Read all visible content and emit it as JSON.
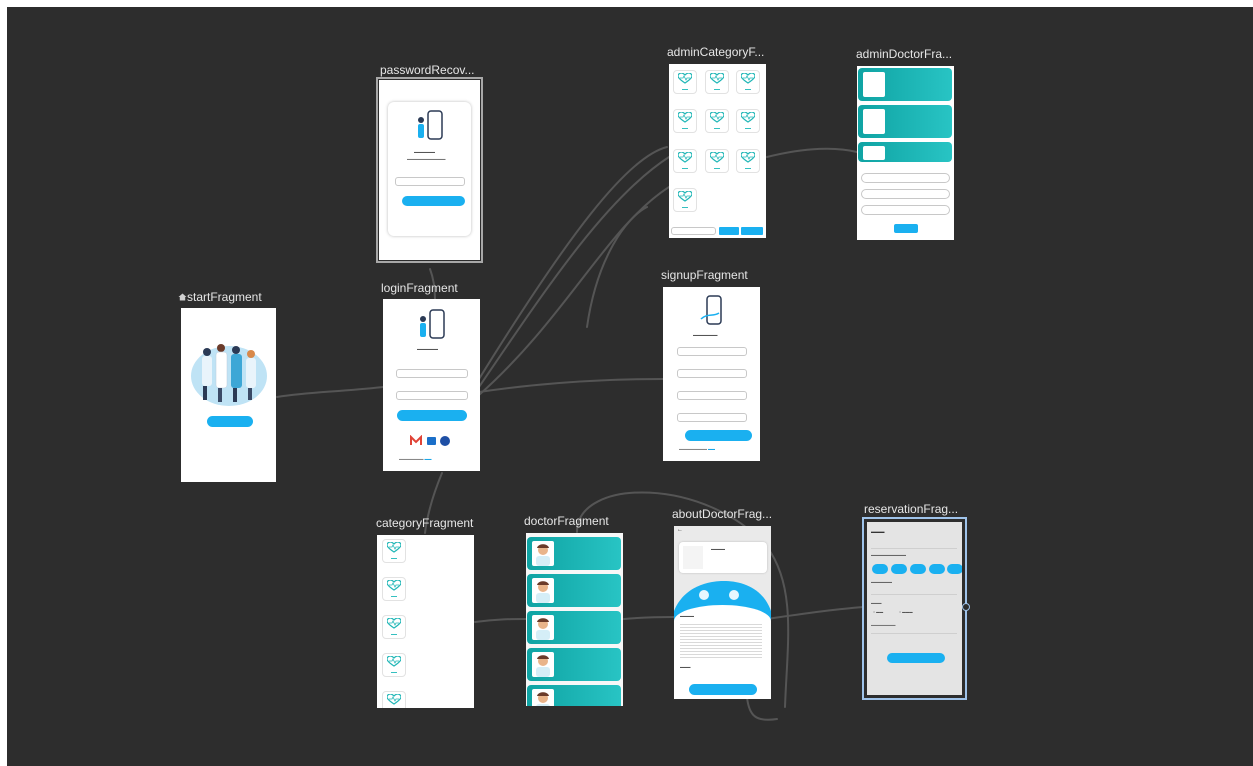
{
  "fragments": {
    "start": {
      "label": "startFragment"
    },
    "passwordRecovery": {
      "label": "passwordRecov..."
    },
    "login": {
      "label": "loginFragment"
    },
    "adminCategory": {
      "label": "adminCategoryF..."
    },
    "adminDoctor": {
      "label": "adminDoctorFra..."
    },
    "signup": {
      "label": "signupFragment"
    },
    "category": {
      "label": "categoryFragment"
    },
    "doctor": {
      "label": "doctorFragment"
    },
    "aboutDoctor": {
      "label": "aboutDoctorFrag..."
    },
    "reservation": {
      "label": "reservationFrag..."
    }
  },
  "colors": {
    "canvas": "#2d2d2d",
    "accent": "#1ab0f0",
    "teal": "#17b3b3",
    "selection": "#9fc3ea"
  },
  "icons": {
    "home": "home-icon"
  }
}
